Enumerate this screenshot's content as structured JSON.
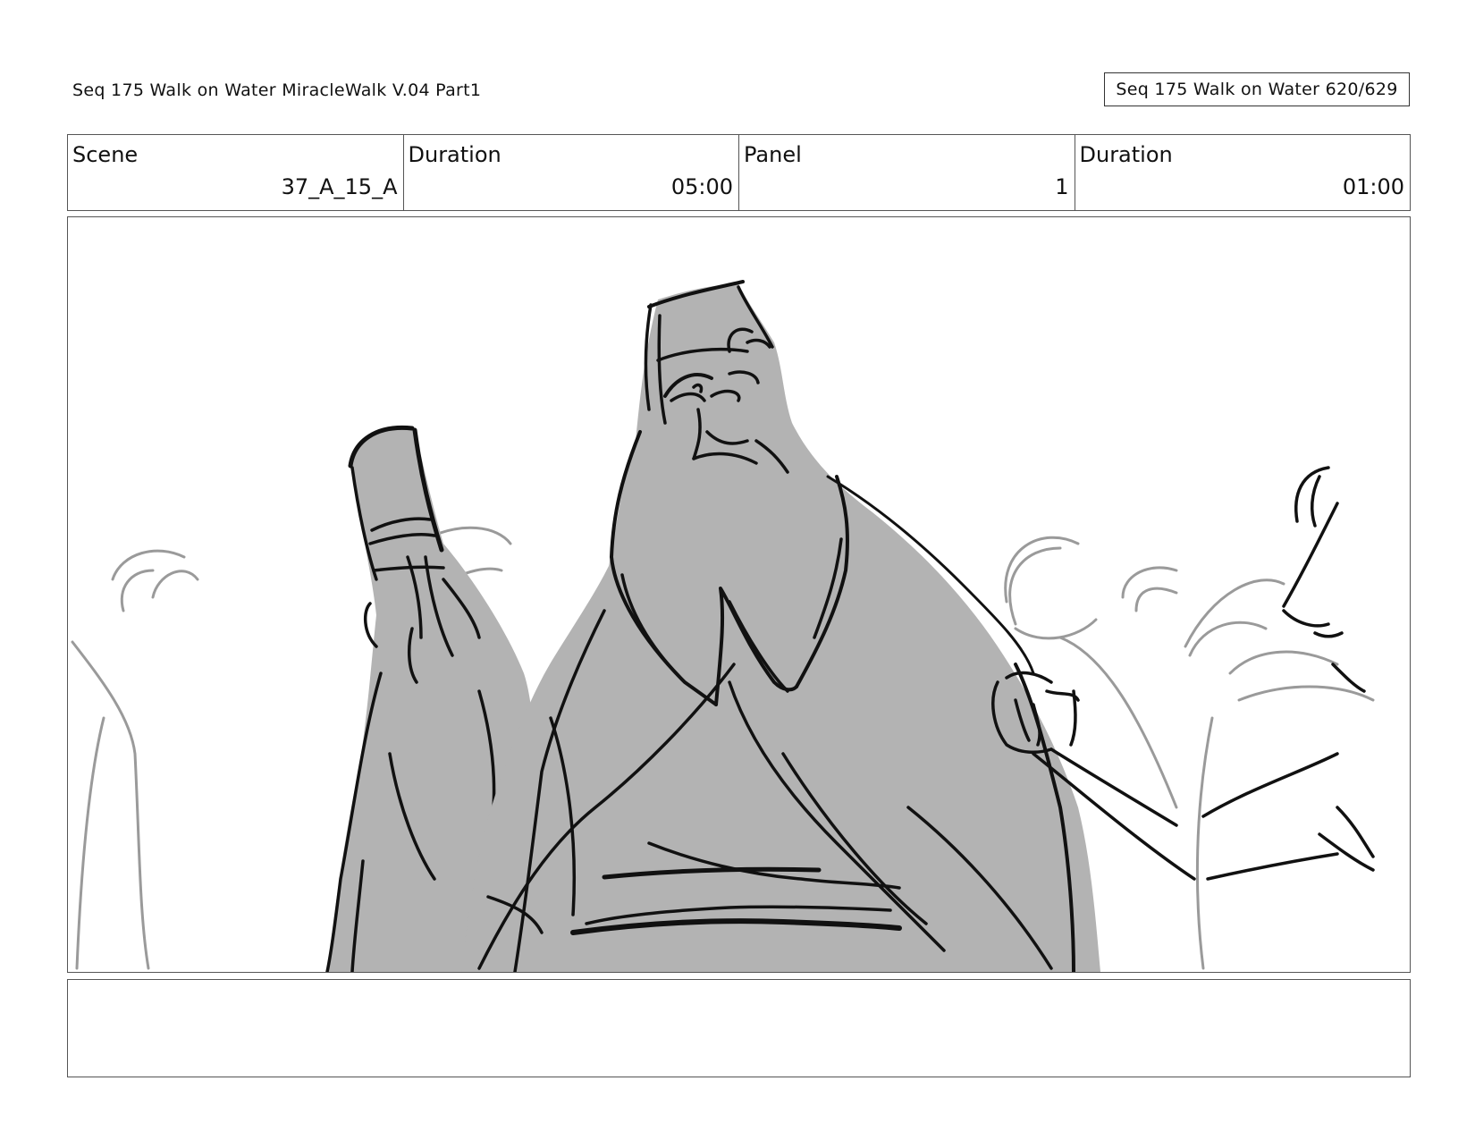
{
  "header": {
    "title": "Seq 175 Walk on Water  MiracleWalk V.04 Part1",
    "page_tag": "Seq 175 Walk on Water 620/629"
  },
  "info": [
    {
      "label": "Scene",
      "value": "37_A_15_A"
    },
    {
      "label": "Duration",
      "value": "05:00"
    },
    {
      "label": "Panel",
      "value": "1"
    },
    {
      "label": "Duration",
      "value": "01:00"
    }
  ],
  "panel": {
    "fill_color": "#b3b3b3",
    "ink_color": "#111111",
    "background_ink_color": "#9a9a9a"
  },
  "notes": {
    "text": ""
  }
}
